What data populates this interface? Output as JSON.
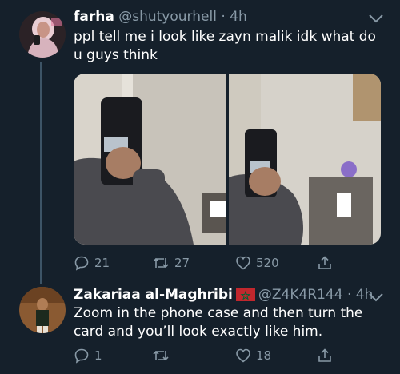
{
  "tweets": [
    {
      "name": "farha",
      "handle": "@shutyourhell",
      "separator": "·",
      "time": "4h",
      "text": "ppl tell me i look like zayn malik idk what do u guys think",
      "stats": {
        "replies": "21",
        "retweets": "27",
        "likes": "520"
      }
    },
    {
      "name": "Zakariaa al-Maghribi",
      "flag": "morocco-flag-icon",
      "handle": "@Z4K4R144",
      "separator": "·",
      "time": "4h",
      "text": "Zoom in the phone case and then turn the card and you’ll look exactly like him.",
      "stats": {
        "replies": "1",
        "retweets": "",
        "likes": "18"
      }
    }
  ],
  "icons": {
    "reply": "reply-icon",
    "retweet": "retweet-icon",
    "like": "like-icon",
    "share": "share-icon",
    "more": "chevron-down-icon"
  },
  "colors": {
    "background": "#15202b",
    "secondary_text": "#8899a6",
    "primary_text": "#ffffff",
    "thread_line": "#3d5466"
  }
}
